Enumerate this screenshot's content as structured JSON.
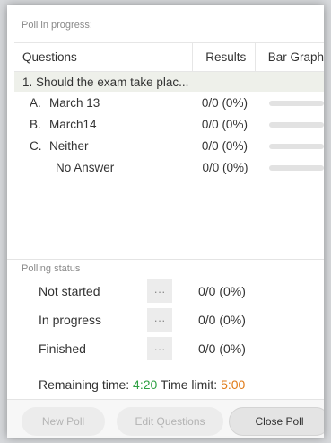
{
  "poll": {
    "caption": "Poll in progress:",
    "columns": {
      "questions": "Questions",
      "results": "Results",
      "bar_graph": "Bar Graph"
    },
    "question": "1. Should the exam take plac...",
    "options": [
      {
        "letter": "A.",
        "label": "March 13",
        "result": "0/0 (0%)",
        "fraction": 0
      },
      {
        "letter": "B.",
        "label": "March14",
        "result": "0/0 (0%)",
        "fraction": 0
      },
      {
        "letter": "C.",
        "label": "Neither",
        "result": "0/0 (0%)",
        "fraction": 0
      }
    ],
    "no_answer": {
      "label": "No Answer",
      "result": "0/0 (0%)",
      "fraction": 0
    }
  },
  "status": {
    "caption": "Polling status",
    "rows": [
      {
        "label": "Not started",
        "dots": "···",
        "value": "0/0 (0%)"
      },
      {
        "label": "In progress",
        "dots": "···",
        "value": "0/0 (0%)"
      },
      {
        "label": "Finished",
        "dots": "···",
        "value": "0/0 (0%)"
      }
    ],
    "remaining_label": "Remaining time:",
    "remaining_value": "4:20",
    "limit_label": "Time limit:",
    "limit_value": "5:00"
  },
  "buttons": {
    "new_poll": "New Poll",
    "edit_questions": "Edit Questions",
    "close_poll": "Close Poll"
  },
  "colors": {
    "remaining": "#2ea043",
    "limit": "#e07a16"
  }
}
